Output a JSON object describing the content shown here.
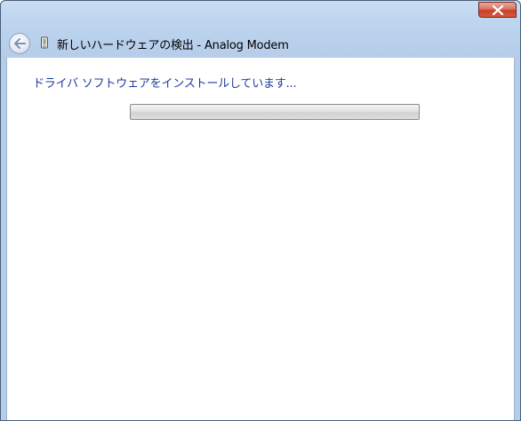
{
  "window": {
    "title": "新しいハードウェアの検出 - Analog Modem",
    "close_icon": "close-icon",
    "back_icon": "back-arrow-icon",
    "wizard_icon": "device-icon"
  },
  "main": {
    "status_text": "ドライバ ソフトウェアをインストールしています...",
    "progress": 0
  },
  "colors": {
    "status_text": "#1e3b9e",
    "close_button": "#c6412a",
    "title_background": "#bcd3ee"
  }
}
